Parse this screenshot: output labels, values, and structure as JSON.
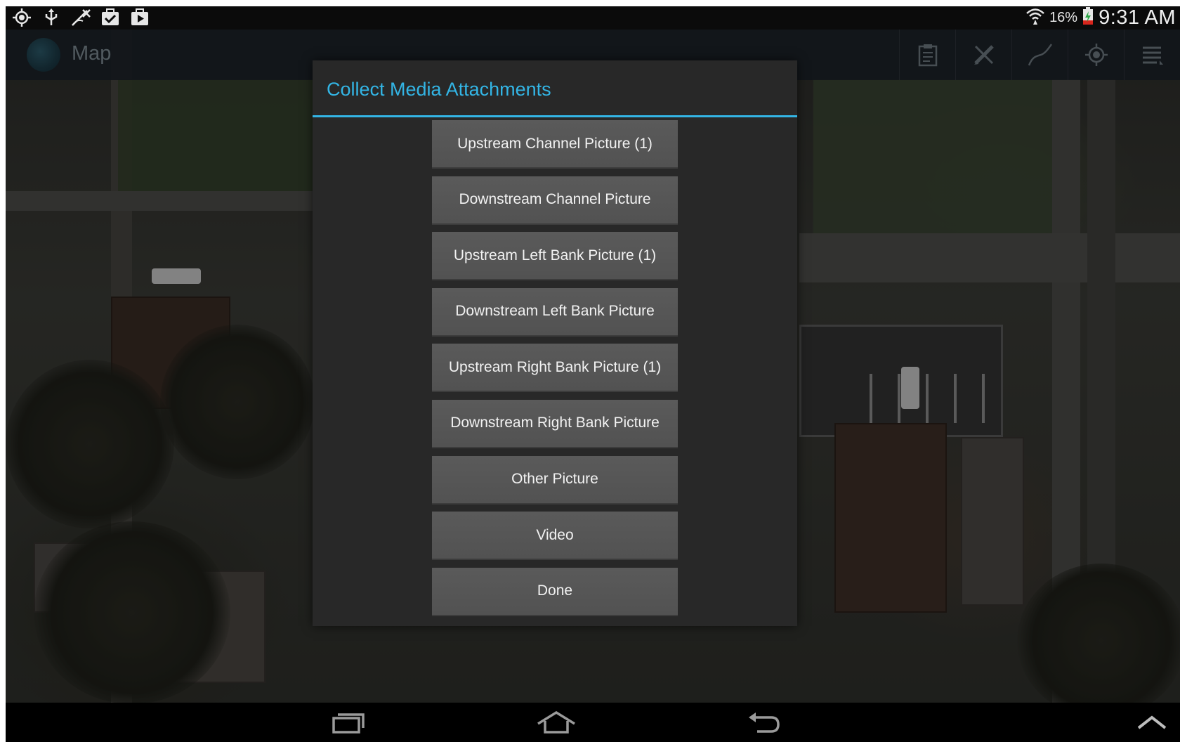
{
  "status_bar": {
    "icons": [
      "gps-icon",
      "usb-icon",
      "no-signal-icon",
      "task-check-icon",
      "media-play-icon"
    ],
    "battery_percent": "16%",
    "time": "9:31 AM"
  },
  "action_bar": {
    "title": "Map",
    "actions": [
      "clipboard-icon",
      "pen-edit-icon",
      "polyline-icon",
      "locate-icon",
      "menu-icon"
    ]
  },
  "dialog": {
    "title": "Collect Media Attachments",
    "buttons": [
      "Upstream Channel Picture (1)",
      "Downstream Channel Picture",
      "Upstream Left Bank Picture (1)",
      "Downstream Left Bank Picture",
      "Upstream Right Bank Picture (1)",
      "Downstream Right Bank Picture",
      "Other Picture",
      "Video",
      "Done"
    ]
  },
  "nav_bar": {
    "buttons": [
      "recent-apps-icon",
      "home-icon",
      "back-icon",
      "chevron-up-icon"
    ]
  },
  "colors": {
    "accent": "#33b5e5",
    "dialog_bg": "#282828",
    "button_bg": "#555555"
  }
}
